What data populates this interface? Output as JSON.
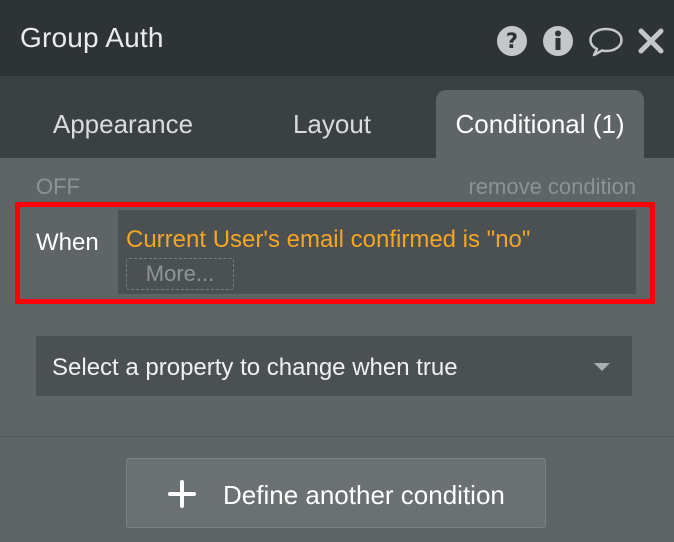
{
  "header": {
    "title": "Group Auth",
    "icons": [
      "help-icon",
      "info-icon",
      "comment-icon",
      "close-icon"
    ]
  },
  "tabs": [
    {
      "label": "Appearance",
      "active": false
    },
    {
      "label": "Layout",
      "active": false
    },
    {
      "label": "Conditional (1)",
      "active": true
    }
  ],
  "condition": {
    "status": "OFF",
    "remove_label": "remove condition",
    "when_label": "When",
    "expression": "Current User's email confirmed is \"no\"",
    "more_label": "More..."
  },
  "property_select": {
    "selected": "Select a property to change when true"
  },
  "define_button": {
    "label": "Define another condition"
  },
  "colors": {
    "expression": "#f4a623",
    "highlight_border": "#ff0000",
    "panel_bg": "#5f6466",
    "header_bg": "#2e3335"
  }
}
